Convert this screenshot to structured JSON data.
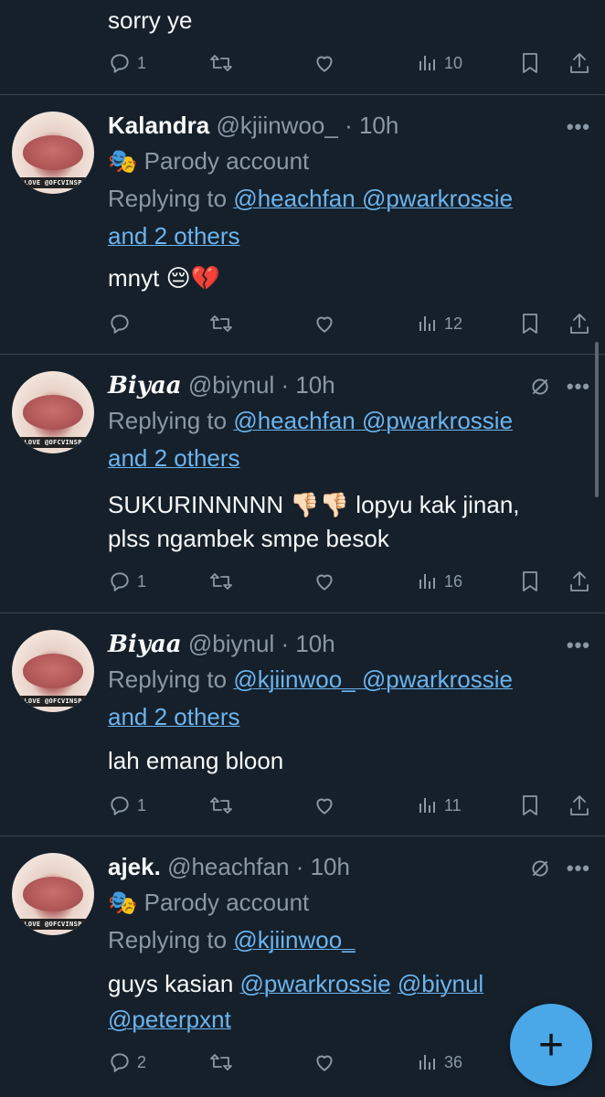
{
  "tweets": [
    {
      "body": "sorry ye",
      "stats": {
        "replies": "1",
        "retweets": "",
        "likes": "",
        "views": "10"
      }
    },
    {
      "name": "Kalandra",
      "handle": "@kjiinwoo_",
      "time": "· 10h",
      "label": "Parody account",
      "replying_prefix": "Replying to ",
      "replying_links": [
        "@heachfan",
        "@pwarkrossie"
      ],
      "replying_more": "and 2 others",
      "body": "mnyt 😔💔",
      "stats": {
        "replies": "",
        "retweets": "",
        "likes": "",
        "views": "12"
      }
    },
    {
      "name": "𝑩𝒊𝒚𝒂𝒂",
      "handle": "@biynul",
      "time": "· 10h",
      "replying_prefix": "Replying to ",
      "replying_links": [
        "@heachfan",
        "@pwarkrossie"
      ],
      "replying_more": "and 2 others",
      "body_line1": "SUKURINNNNN 👎🏻👎🏻 lopyu kak jinan,",
      "body_line2": "plss ngambek smpe besok",
      "stats": {
        "replies": "1",
        "retweets": "",
        "likes": "",
        "views": "16"
      }
    },
    {
      "name": "𝑩𝒊𝒚𝒂𝒂",
      "handle": "@biynul",
      "time": "· 10h",
      "replying_prefix": "Replying to ",
      "replying_links": [
        "@kjiinwoo_",
        "@pwarkrossie"
      ],
      "replying_more": "and 2 others",
      "body": "lah emang bloon",
      "stats": {
        "replies": "1",
        "retweets": "",
        "likes": "",
        "views": "11"
      }
    },
    {
      "name": "ajek.",
      "handle": "@heachfan",
      "time": "· 10h",
      "label": "Parody account",
      "replying_prefix": "Replying to ",
      "replying_links": [
        "@kjiinwoo_"
      ],
      "body_prefix": "guys kasian ",
      "body_links": [
        "@pwarkrossie",
        "@biynul",
        "@peterpxnt"
      ],
      "stats": {
        "replies": "2",
        "retweets": "",
        "likes": "",
        "views": "36"
      }
    }
  ],
  "avatar_caption": "LOVE @OFCVINSP",
  "fab_label": "+",
  "icons": {
    "reply": "reply-icon",
    "retweet": "retweet-icon",
    "like": "heart-icon",
    "views": "views-icon",
    "bookmark": "bookmark-icon",
    "share": "share-icon",
    "more": "more-icon",
    "mute": "muted-icon",
    "parody": "parody-mask-icon"
  },
  "colors": {
    "background": "#15202b",
    "link": "#6cb4ee",
    "muted": "#8b98a5",
    "fab": "#4aa8e8"
  }
}
